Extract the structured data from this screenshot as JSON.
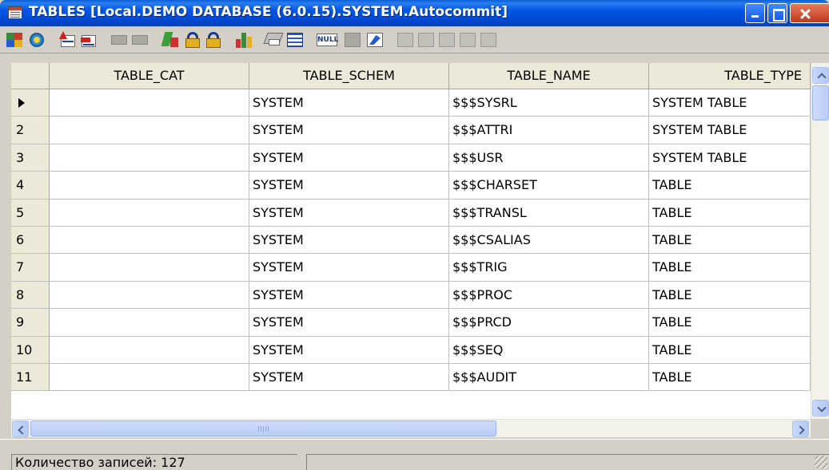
{
  "window": {
    "title": "TABLES [Local.DEMO DATABASE (6.0.15).SYSTEM.Autocommit]"
  },
  "toolbar": {
    "buttons": [
      "open-icon",
      "refresh-icon",
      "insert-row-icon",
      "delete-row-icon",
      "post-icon",
      "cancel-icon",
      "filter-icon",
      "lock-icon",
      "unlock-icon",
      "chart-icon",
      "print-icon",
      "grid-icon",
      "null-icon",
      "blank-icon",
      "edit-icon",
      "blob-icon-1",
      "blob-icon-2",
      "blob-icon-3",
      "blob-icon-4",
      "blob-icon-5"
    ],
    "null_label": "NULL"
  },
  "grid": {
    "columns": [
      "TABLE_CAT",
      "TABLE_SCHEM",
      "TABLE_NAME",
      "TABLE_TYPE"
    ],
    "rows": [
      {
        "num": "",
        "cat": "",
        "schem": "SYSTEM",
        "name": "$$$SYSRL",
        "type": "SYSTEM TABLE",
        "current": true
      },
      {
        "num": "2",
        "cat": "",
        "schem": "SYSTEM",
        "name": "$$$ATTRI",
        "type": "SYSTEM TABLE"
      },
      {
        "num": "3",
        "cat": "",
        "schem": "SYSTEM",
        "name": "$$$USR",
        "type": "SYSTEM TABLE"
      },
      {
        "num": "4",
        "cat": "",
        "schem": "SYSTEM",
        "name": "$$$CHARSET",
        "type": "TABLE"
      },
      {
        "num": "5",
        "cat": "",
        "schem": "SYSTEM",
        "name": "$$$TRANSL",
        "type": "TABLE"
      },
      {
        "num": "6",
        "cat": "",
        "schem": "SYSTEM",
        "name": "$$$CSALIAS",
        "type": "TABLE"
      },
      {
        "num": "7",
        "cat": "",
        "schem": "SYSTEM",
        "name": "$$$TRIG",
        "type": "TABLE"
      },
      {
        "num": "8",
        "cat": "",
        "schem": "SYSTEM",
        "name": "$$$PROC",
        "type": "TABLE"
      },
      {
        "num": "9",
        "cat": "",
        "schem": "SYSTEM",
        "name": "$$$PRCD",
        "type": "TABLE"
      },
      {
        "num": "10",
        "cat": "",
        "schem": "SYSTEM",
        "name": "$$$SEQ",
        "type": "TABLE"
      },
      {
        "num": "11",
        "cat": "",
        "schem": "SYSTEM",
        "name": "$$$AUDIT",
        "type": "TABLE"
      }
    ]
  },
  "status": {
    "record_count": "Количество записей: 127",
    "second_pane": ""
  },
  "colors": {
    "titlebar": "#0055e5",
    "chrome": "#d4d0c8",
    "header_bg": "#ece9d8",
    "scroll_thumb": "#b9ccf7"
  }
}
